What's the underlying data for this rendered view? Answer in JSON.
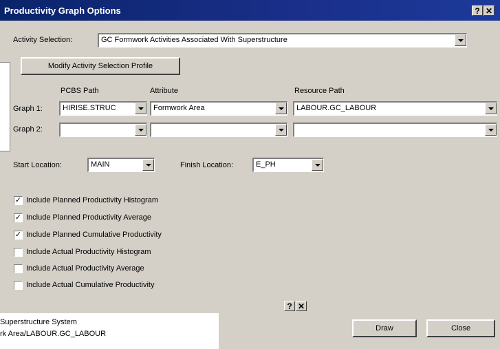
{
  "window": {
    "title": "Productivity Graph Options",
    "help_label": "?",
    "close_label": "✕"
  },
  "activity": {
    "label": "Activity Selection:",
    "value": "GC Formwork Activities Associated With Superstructure",
    "modify_button": "Modify Activity Selection Profile"
  },
  "columns": {
    "pcbs": "PCBS Path",
    "attribute": "Attribute",
    "resource": "Resource Path"
  },
  "graph1": {
    "label": "Graph 1:",
    "pcbs": "HIRISE.STRUC",
    "attribute": "Formwork Area",
    "resource": "LABOUR.GC_LABOUR"
  },
  "graph2": {
    "label": "Graph 2:",
    "pcbs": "",
    "attribute": "",
    "resource": ""
  },
  "location": {
    "start_label": "Start Location:",
    "start_value": "MAIN",
    "finish_label": "Finish Location:",
    "finish_value": "E_PH"
  },
  "options": [
    {
      "label": "Include Planned Productivity Histogram",
      "checked": true
    },
    {
      "label": "Include Planned Productivity Average",
      "checked": true
    },
    {
      "label": "Include Planned Cumulative Productivity",
      "checked": true
    },
    {
      "label": "Include Actual Productivity Histogram",
      "checked": false
    },
    {
      "label": "Include Actual Productivity Average",
      "checked": false
    },
    {
      "label": "Include Actual Cumulative Productivity",
      "checked": false
    }
  ],
  "buttons": {
    "draw": "Draw",
    "close": "Close"
  },
  "background_window": {
    "help_label": "?",
    "close_label": "✕",
    "line1": "Superstructure System",
    "line2": "rk Area/LABOUR.GC_LABOUR"
  }
}
